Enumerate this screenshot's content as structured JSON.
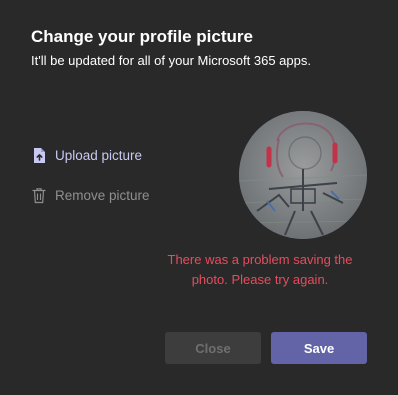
{
  "dialog": {
    "title": "Change your profile picture",
    "subtitle": "It'll be updated for all of your Microsoft 365 apps."
  },
  "actions": {
    "upload_label": "Upload picture",
    "upload_icon": "upload-file-icon",
    "remove_label": "Remove picture",
    "remove_icon": "trash-icon"
  },
  "error_message": "There was a problem saving the photo. Please try again.",
  "buttons": {
    "close_label": "Close",
    "save_label": "Save"
  },
  "colors": {
    "background": "#292929",
    "accent": "#6264a7",
    "error": "#e74c5e",
    "upload_link": "#c7c9f2"
  }
}
